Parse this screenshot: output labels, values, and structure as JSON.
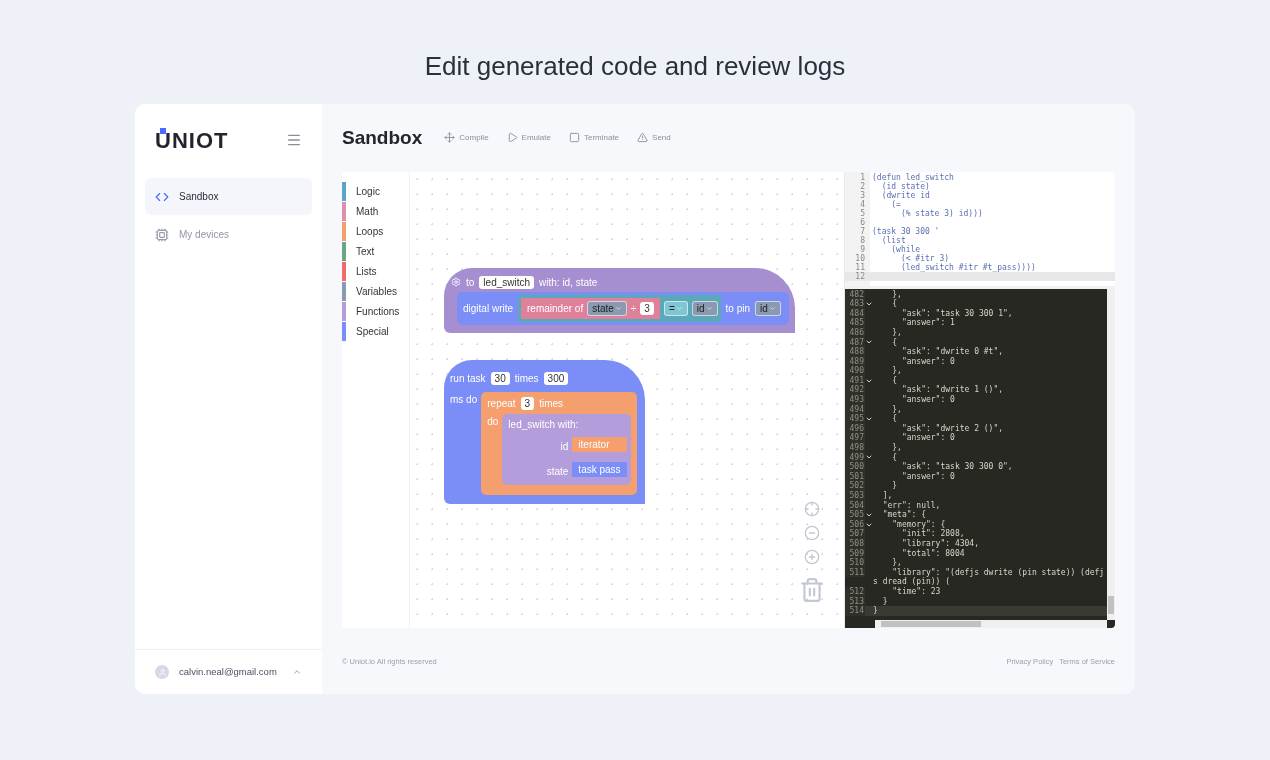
{
  "page_title": "Edit generated code and review logs",
  "sidebar": {
    "logo": "UNIOT",
    "nav": [
      {
        "label": "Sandbox",
        "kind": "code",
        "selected": true
      },
      {
        "label": "My devices",
        "kind": "device",
        "selected": false
      }
    ],
    "user": {
      "email": "calvin.neal@gmail.com"
    }
  },
  "header": {
    "title": "Sandbox",
    "actions": [
      {
        "label": "Compile",
        "kind": "compile"
      },
      {
        "label": "Emulate",
        "kind": "emulate"
      },
      {
        "label": "Terminate",
        "kind": "terminate"
      },
      {
        "label": "Send",
        "kind": "send"
      }
    ]
  },
  "toolbox": [
    {
      "label": "Logic",
      "color": "#5ba5c8"
    },
    {
      "label": "Math",
      "color": "#e08fa8"
    },
    {
      "label": "Loops",
      "color": "#f59e6e"
    },
    {
      "label": "Text",
      "color": "#6aa58a"
    },
    {
      "label": "Lists",
      "color": "#ef6b6b"
    },
    {
      "label": "Variables",
      "color": "#8a9ab0"
    },
    {
      "label": "Functions",
      "color": "#b39ddb"
    },
    {
      "label": "Special",
      "color": "#7b8ef7"
    }
  ],
  "blocks": {
    "function": {
      "to": "to",
      "name": "led_switch",
      "params": "with: id, state",
      "write": "digital write",
      "remainder": "remainder of",
      "var": "state",
      "op": "÷",
      "divisor": "3",
      "compare": "=",
      "compare_to": "id",
      "to_pin": "to pin",
      "pin": "id"
    },
    "task": {
      "run": "run task",
      "period": "30",
      "times": "times",
      "count": "300",
      "ms_do": "ms do",
      "repeat": "repeat",
      "repeat_count": "3",
      "repeat_times": "times",
      "do": "do",
      "call": "led_switch with:",
      "arg1": "id",
      "arg1_value": "iterator",
      "arg2": "state",
      "arg2_value": "task pass"
    }
  },
  "editor": {
    "lines": [
      {
        "number": "1",
        "text": "(defun led_switch",
        "current": false
      },
      {
        "number": "2",
        "text": "  (id state)",
        "current": false
      },
      {
        "number": "3",
        "text": "  (dwrite id",
        "current": false
      },
      {
        "number": "4",
        "text": "    (=",
        "current": false
      },
      {
        "number": "5",
        "text": "      (% state 3) id)))",
        "current": false
      },
      {
        "number": "6",
        "current": false
      },
      {
        "number": "7",
        "text": "(task 30 300 '",
        "current": false
      },
      {
        "number": "8",
        "text": "  (list",
        "current": false
      },
      {
        "number": "9",
        "text": "    (while",
        "current": false
      },
      {
        "number": "10",
        "text": "      (< #itr 3)",
        "current": false
      },
      {
        "number": "11",
        "text": "      (led_switch #itr #t_pass))))",
        "current": false
      },
      {
        "number": "12",
        "current": true
      }
    ]
  },
  "log": {
    "lines": [
      {
        "number": "482",
        "text": "    },",
        "fold": false,
        "current": false
      },
      {
        "number": "483",
        "text": "    {",
        "fold": true,
        "current": false
      },
      {
        "number": "484",
        "text": "      \"ask\": \"task 30 300 1\",",
        "fold": false,
        "current": false
      },
      {
        "number": "485",
        "text": "      \"answer\": 1",
        "fold": false,
        "current": false
      },
      {
        "number": "486",
        "text": "    },",
        "fold": false,
        "current": false
      },
      {
        "number": "487",
        "text": "    {",
        "fold": true,
        "current": false
      },
      {
        "number": "488",
        "text": "      \"ask\": \"dwrite 0 #t\",",
        "fold": false,
        "current": false
      },
      {
        "number": "489",
        "text": "      \"answer\": 0",
        "fold": false,
        "current": false
      },
      {
        "number": "490",
        "text": "    },",
        "fold": false,
        "current": false
      },
      {
        "number": "491",
        "text": "    {",
        "fold": true,
        "current": false
      },
      {
        "number": "492",
        "text": "      \"ask\": \"dwrite 1 ()\",",
        "fold": false,
        "current": false
      },
      {
        "number": "493",
        "text": "      \"answer\": 0",
        "fold": false,
        "current": false
      },
      {
        "number": "494",
        "text": "    },",
        "fold": false,
        "current": false
      },
      {
        "number": "495",
        "text": "    {",
        "fold": true,
        "current": false
      },
      {
        "number": "496",
        "text": "      \"ask\": \"dwrite 2 ()\",",
        "fold": false,
        "current": false
      },
      {
        "number": "497",
        "text": "      \"answer\": 0",
        "fold": false,
        "current": false
      },
      {
        "number": "498",
        "text": "    },",
        "fold": false,
        "current": false
      },
      {
        "number": "499",
        "text": "    {",
        "fold": true,
        "current": false
      },
      {
        "number": "500",
        "text": "      \"ask\": \"task 30 300 0\",",
        "fold": false,
        "current": false
      },
      {
        "number": "501",
        "text": "      \"answer\": 0",
        "fold": false,
        "current": false
      },
      {
        "number": "502",
        "text": "    }",
        "fold": false,
        "current": false
      },
      {
        "number": "503",
        "text": "  ],",
        "fold": false,
        "current": false
      },
      {
        "number": "504",
        "text": "  \"err\": null,",
        "fold": false,
        "current": false
      },
      {
        "number": "505",
        "text": "  \"meta\": {",
        "fold": true,
        "current": false
      },
      {
        "number": "506",
        "text": "    \"memory\": {",
        "fold": true,
        "current": false
      },
      {
        "number": "507",
        "text": "      \"init\": 2808,",
        "fold": false,
        "current": false
      },
      {
        "number": "508",
        "text": "      \"library\": 4304,",
        "fold": false,
        "current": false
      },
      {
        "number": "509",
        "text": "      \"total\": 8004",
        "fold": false,
        "current": false
      },
      {
        "number": "510",
        "text": "    },",
        "fold": false,
        "current": false
      },
      {
        "number": "511",
        "text": "    \"library\": \"(defjs dwrite (pin state)) (defjs dread (pin)) (",
        "fold": false,
        "current": false
      },
      {
        "number": "512",
        "text": "    \"time\": 23",
        "fold": false,
        "current": false
      },
      {
        "number": "513",
        "text": "  }",
        "fold": false,
        "current": false
      },
      {
        "number": "514",
        "text": "}",
        "fold": false,
        "current": true
      }
    ]
  },
  "footer": {
    "copyright": "© Uniot.io All rights reserved",
    "links": [
      "Privacy Policy",
      "Terms of Service"
    ]
  }
}
